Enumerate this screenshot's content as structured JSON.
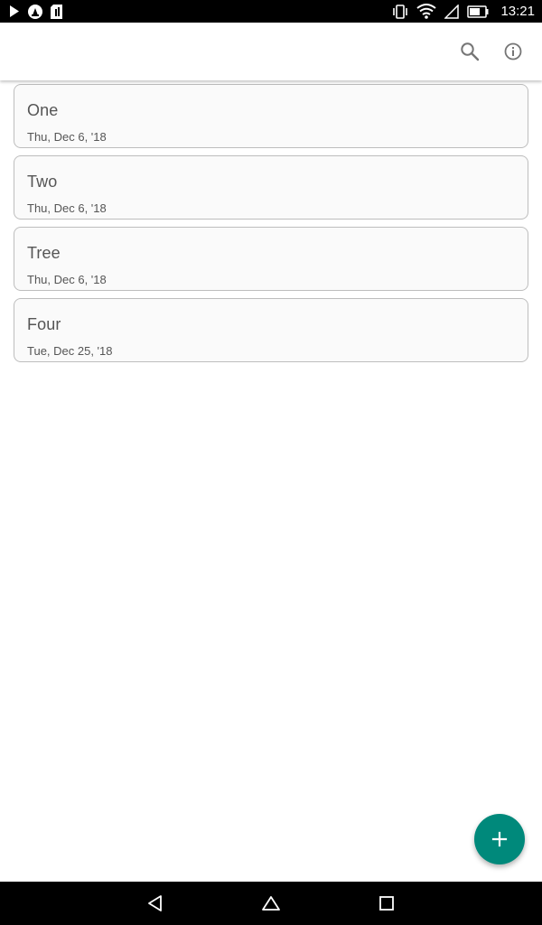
{
  "status_bar": {
    "time": "13:21",
    "icons": [
      "play-store-icon",
      "notification-icon",
      "sd-card-icon",
      "vibrate-icon",
      "wifi-icon",
      "signal-icon",
      "battery-icon"
    ]
  },
  "app_bar": {
    "actions": [
      "search-icon",
      "info-icon"
    ]
  },
  "notes": [
    {
      "title": "One",
      "date": "Thu, Dec 6, '18"
    },
    {
      "title": "Two",
      "date": "Thu, Dec 6, '18"
    },
    {
      "title": "Tree",
      "date": "Thu, Dec 6, '18"
    },
    {
      "title": "Four",
      "date": "Tue, Dec 25, '18"
    }
  ],
  "fab": {
    "icon": "plus-icon",
    "color": "#00897b"
  },
  "nav_bar": {
    "buttons": [
      "back-icon",
      "home-icon",
      "recents-icon"
    ]
  },
  "colors": {
    "card_background": "#fafafa",
    "card_border": "#bdbdbd",
    "text": "#555555",
    "accent": "#00897b"
  }
}
